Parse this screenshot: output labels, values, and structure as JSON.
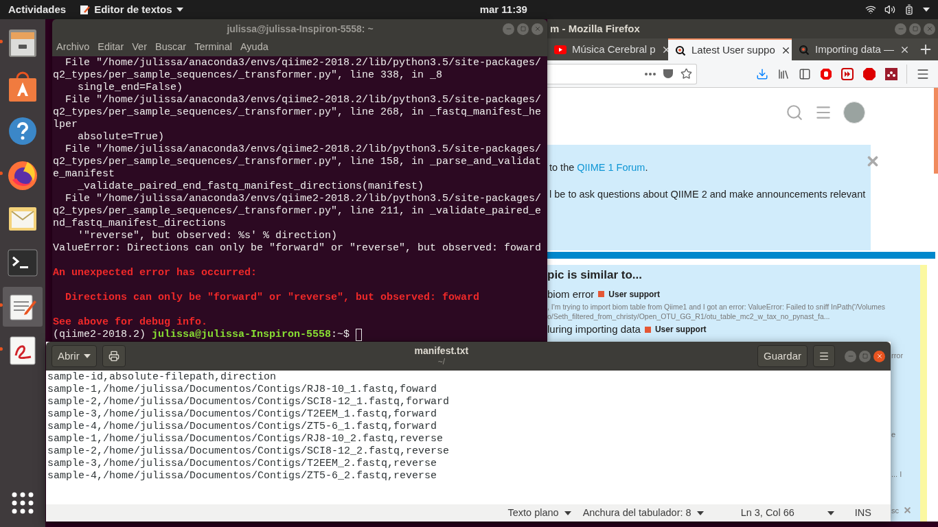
{
  "top_bar": {
    "activities": "Actividades",
    "app_menu": "Editor de textos",
    "clock": "mar 11:39"
  },
  "dock": [
    {
      "kind": "files",
      "running": true,
      "selected": false
    },
    {
      "kind": "store",
      "running": false,
      "selected": false
    },
    {
      "kind": "help",
      "running": false,
      "selected": false
    },
    {
      "kind": "firefox",
      "running": true,
      "selected": false
    },
    {
      "kind": "mail",
      "running": false,
      "selected": false
    },
    {
      "kind": "terminal",
      "running": false,
      "selected": false
    },
    {
      "kind": "editor",
      "running": true,
      "selected": true
    },
    {
      "kind": "viewer",
      "running": true,
      "selected": false
    },
    {
      "kind": "apps",
      "running": false,
      "selected": false
    }
  ],
  "firefox": {
    "title": "m - Mozilla Firefox",
    "focused": false,
    "tabs": [
      {
        "label": "Música Cerebral p",
        "selected": false
      },
      {
        "label": "Latest User suppo",
        "selected": true
      },
      {
        "label": "Importing data —",
        "selected": false
      }
    ],
    "banner": {
      "lead": "to the ",
      "link": "QIIME 1 Forum",
      "tail": ".",
      "line2": "l be to ask questions about QIIME 2 and make announcements relevant"
    },
    "similar": {
      "heading": "pic is similar to...",
      "topics": [
        {
          "title": "biom error",
          "category": "User support",
          "color": "#e45735",
          "excerpt": [
            ", I'm trying to import biom table from Qiime1 and I got an error: ValueError: Failed to sniff InPath('/Volumes",
            "o/Seth_filtered_from_christy/Open_OTU_GG_R1/otu_table_mc2_w_tax_no_pynast_fa..."
          ]
        },
        {
          "title": "luring importing data",
          "category": "User support",
          "color": "#e45735"
        }
      ],
      "fragments": [
        "rror",
        "e",
        "... I",
        "sc"
      ]
    }
  },
  "terminal": {
    "title": "julissa@julissa-Inspiron-5558: ~",
    "focused": false,
    "menu": [
      "Archivo",
      "Editar",
      "Ver",
      "Buscar",
      "Terminal",
      "Ayuda"
    ],
    "lines": [
      {
        "kind": "normal",
        "text": "  File \"/home/julissa/anaconda3/envs/qiime2-2018.2/lib/python3.5/site-packages/"
      },
      {
        "kind": "normal",
        "text": "q2_types/per_sample_sequences/_transformer.py\", line 338, in _8"
      },
      {
        "kind": "normal",
        "text": "    single_end=False)"
      },
      {
        "kind": "normal",
        "text": "  File \"/home/julissa/anaconda3/envs/qiime2-2018.2/lib/python3.5/site-packages/"
      },
      {
        "kind": "normal",
        "text": "q2_types/per_sample_sequences/_transformer.py\", line 268, in _fastq_manifest_he"
      },
      {
        "kind": "normal",
        "text": "lper"
      },
      {
        "kind": "normal",
        "text": "    absolute=True)"
      },
      {
        "kind": "normal",
        "text": "  File \"/home/julissa/anaconda3/envs/qiime2-2018.2/lib/python3.5/site-packages/"
      },
      {
        "kind": "normal",
        "text": "q2_types/per_sample_sequences/_transformer.py\", line 158, in _parse_and_validat"
      },
      {
        "kind": "normal",
        "text": "e_manifest"
      },
      {
        "kind": "normal",
        "text": "    _validate_paired_end_fastq_manifest_directions(manifest)"
      },
      {
        "kind": "normal",
        "text": "  File \"/home/julissa/anaconda3/envs/qiime2-2018.2/lib/python3.5/site-packages/"
      },
      {
        "kind": "normal",
        "text": "q2_types/per_sample_sequences/_transformer.py\", line 211, in _validate_paired_e"
      },
      {
        "kind": "normal",
        "text": "nd_fastq_manifest_directions"
      },
      {
        "kind": "normal",
        "text": "    '\"reverse\", but observed: %s' % direction)"
      },
      {
        "kind": "normal",
        "text": "ValueError: Directions can only be \"forward\" or \"reverse\", but observed: foward"
      },
      {
        "kind": "blank"
      },
      {
        "kind": "error",
        "text": "An unexpected error has occurred:"
      },
      {
        "kind": "blank"
      },
      {
        "kind": "error",
        "text": "  Directions can only be \"forward\" or \"reverse\", but observed: foward"
      },
      {
        "kind": "blank"
      },
      {
        "kind": "error",
        "text": "See above for debug info."
      },
      {
        "kind": "prompt",
        "env": "(qiime2-2018.2) ",
        "user": "julissa@julissa-Inspiron-5558",
        "path": ":~$ "
      }
    ]
  },
  "editor": {
    "open_button": "Abrir",
    "title": "manifest.txt",
    "subtitle": "~/",
    "save_button": "Guardar",
    "focused": true,
    "lines": [
      "sample-id,absolute-filepath,direction",
      "sample-1,/home/julissa/Documentos/Contigs/RJ8-10_1.fastq,foward",
      "sample-2,/home/julissa/Documentos/Contigs/SCI8-12_1.fastq,forward",
      "sample-3,/home/julissa/Documentos/Contigs/T2EEM_1.fastq,forward",
      "sample-4,/home/julissa/Documentos/Contigs/ZT5-6_1.fastq,forward",
      "sample-1,/home/julissa/Documentos/Contigs/RJ8-10_2.fastq,reverse",
      "sample-2,/home/julissa/Documentos/Contigs/SCI8-12_2.fastq,reverse",
      "sample-3,/home/julissa/Documentos/Contigs/T2EEM_2.fastq,reverse",
      "sample-4,/home/julissa/Documentos/Contigs/ZT5-6_2.fastq,reverse"
    ],
    "status": {
      "language": "Texto plano",
      "tab_width": "Anchura del tabulador: 8",
      "position": "Ln 3, Col 66",
      "mode": "INS"
    }
  }
}
